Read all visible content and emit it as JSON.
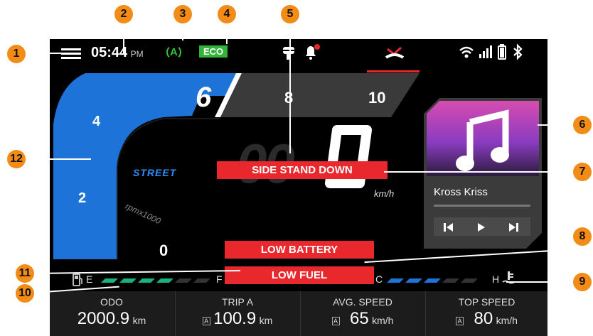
{
  "status": {
    "time": "05:44",
    "ampm": "PM",
    "auto_label": "A",
    "eco_label": "ECO"
  },
  "tach": {
    "marks": [
      "6",
      "8",
      "10",
      "4",
      "2",
      "0"
    ],
    "mode": "STREET",
    "unit": "rpmx1000"
  },
  "speed": {
    "value": "00",
    "unit": "km/h"
  },
  "alerts": {
    "side_stand": "SIDE STAND DOWN",
    "low_battery": "LOW BATTERY",
    "low_fuel": "LOW FUEL"
  },
  "music": {
    "title": "Kross Kriss"
  },
  "fuel": {
    "empty": "E",
    "full": "F"
  },
  "temp": {
    "cold": "C",
    "hot": "H"
  },
  "stats": [
    {
      "label": "ODO",
      "value": "2000.9",
      "unit": "km",
      "badge": ""
    },
    {
      "label": "TRIP A",
      "value": "100.9",
      "unit": "km",
      "badge": "A"
    },
    {
      "label": "AVG. SPEED",
      "value": "65",
      "unit": "km/h",
      "badge": "A"
    },
    {
      "label": "TOP SPEED",
      "value": "80",
      "unit": "km/h",
      "badge": "A"
    }
  ],
  "callouts": [
    "1",
    "2",
    "3",
    "4",
    "5",
    "6",
    "7",
    "8",
    "9",
    "10",
    "11",
    "12"
  ],
  "colors": {
    "tach_blue": "#1e73d8",
    "alert_red": "#e8282c",
    "eco_green": "#33b33a",
    "callout_orange": "#f28c16"
  }
}
